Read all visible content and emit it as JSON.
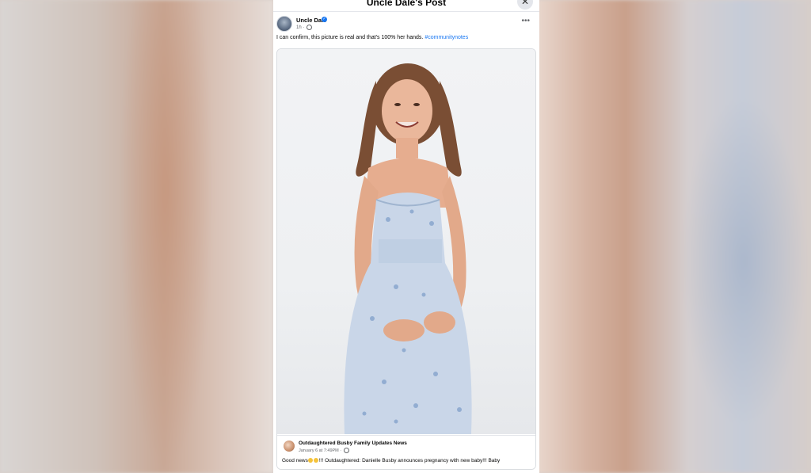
{
  "dialog": {
    "title": "Uncle Dale's Post",
    "close_icon": "close-icon"
  },
  "post": {
    "author": "Uncle Dale",
    "meta": "1h · ",
    "text": "I can confirm, this picture is real and that's 100% her hands.",
    "hashtag": "#communitynotes"
  },
  "shared_post": {
    "page_name": "Outdaughtered Busby Family Updates News",
    "date": "January 6 at 7:49PM · ",
    "text_before_emoji": "Good news",
    "text_after_emoji": "!!! Outdaughtered: Danielle Busby announces pregnancy with new baby!!! Baby"
  },
  "colors": {
    "link": "#1877f2",
    "text": "#050505",
    "secondary": "#65676b",
    "dress": "#c9d6e8"
  }
}
